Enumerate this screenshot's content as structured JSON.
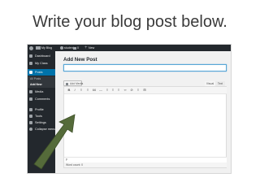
{
  "slide_title": "Write your blog post below.",
  "admin_bar": {
    "site_name": "My Blog",
    "user_label": "student",
    "comments_count": "0",
    "new_label": "New"
  },
  "sidebar": {
    "items": [
      {
        "label": "Dashboard",
        "icon": "dashboard-icon"
      },
      {
        "label": "My Class",
        "icon": "class-icon"
      },
      {
        "label": "Posts",
        "icon": "pin-icon"
      },
      {
        "label": "Media",
        "icon": "media-icon"
      },
      {
        "label": "Comments",
        "icon": "comments-icon"
      },
      {
        "label": "Profile",
        "icon": "profile-icon"
      },
      {
        "label": "Tools",
        "icon": "tools-icon"
      },
      {
        "label": "Settings",
        "icon": "settings-icon"
      },
      {
        "label": "Collapse menu",
        "icon": "collapse-icon"
      }
    ],
    "submenu": [
      "All Posts",
      "Add New"
    ]
  },
  "editor": {
    "page_title": "Add New Post",
    "title_value": "",
    "add_media_label": "Add Media",
    "tab_visual": "Visual",
    "tab_text": "Text",
    "toolbar": [
      "B",
      "I",
      "≡",
      "≡",
      "66",
      "—",
      "≡",
      "≡",
      "≡",
      "∞",
      "⊘",
      "≡",
      "⊞"
    ],
    "content": "",
    "path": "p",
    "word_count": "Word count: 0"
  },
  "colors": {
    "admin_dark": "#23282d",
    "accent": "#0073aa",
    "arrow_fill": "#556b3a"
  }
}
